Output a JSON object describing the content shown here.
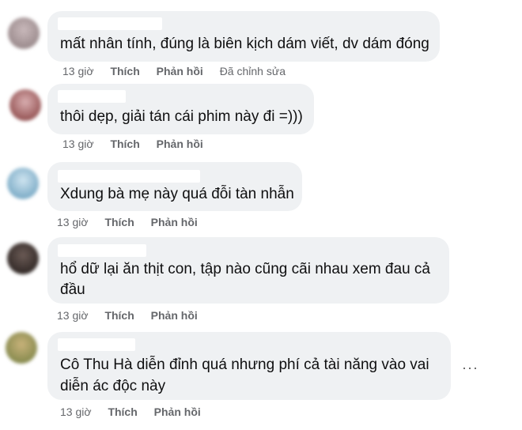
{
  "comments": [
    {
      "text_lines": [
        "mất nhân tính, đúng là biên kịch dám viết, dv dám đóng"
      ],
      "time": "13 giờ",
      "like": "Thích",
      "reply": "Phản hồi",
      "edited": "Đã chỉnh sửa",
      "avatar_color": "#9b8a8c"
    },
    {
      "text_lines": [
        "thôi dẹp, giải tán cái phim này đi =)))"
      ],
      "time": "13 giờ",
      "like": "Thích",
      "reply": "Phản hồi",
      "avatar_color": "#8a4a4a"
    },
    {
      "text_lines": [
        "Xdung bà mẹ này quá đỗi tàn nhẫn"
      ],
      "time": "13 giờ",
      "like": "Thích",
      "reply": "Phản hồi",
      "avatar_color": "#6f9fbf"
    },
    {
      "text_lines": [
        "hổ dữ lại ăn thịt con, tập nào cũng cãi nhau xem đau cả",
        "đầu"
      ],
      "time": "13 giờ",
      "like": "Thích",
      "reply": "Phản hồi",
      "avatar_color": "#3a3230"
    },
    {
      "text_lines": [
        "Cô Thu Hà diễn đỉnh quá nhưng phí cả tài năng vào vai",
        "diễn ác độc này"
      ],
      "time": "13 giờ",
      "like": "Thích",
      "reply": "Phản hồi",
      "avatar_color": "#8f9a58"
    }
  ],
  "more_options_icon": "more-horizontal-icon",
  "more_label": "···"
}
